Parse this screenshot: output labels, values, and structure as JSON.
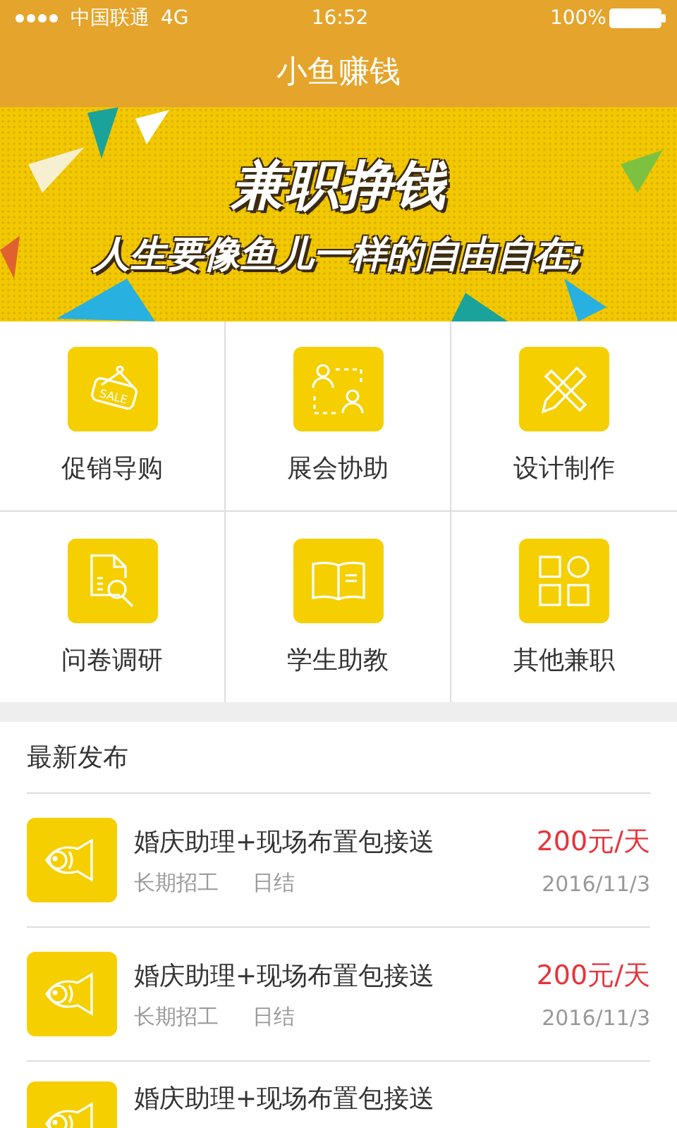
{
  "status_bar": {
    "carrier": "中国联通",
    "network": "4G",
    "time": "16:52",
    "battery": "100%"
  },
  "nav_bar": {
    "title": "小鱼赚钱"
  },
  "banner": {
    "headline": "兼职挣钱",
    "slogan": "人生要像鱼儿一样的自由自在;"
  },
  "categories": [
    {
      "label": "促销导购",
      "kind": "sale",
      "icon_text": "SALE"
    },
    {
      "label": "展会协助",
      "kind": "people"
    },
    {
      "label": "设计制作",
      "kind": "design"
    },
    {
      "label": "问卷调研",
      "kind": "survey"
    },
    {
      "label": "学生助教",
      "kind": "book"
    },
    {
      "label": "其他兼职",
      "kind": "grid"
    }
  ],
  "latest": {
    "heading": "最新发布",
    "jobs": [
      {
        "title": "婚庆助理+现场布置包接送",
        "term": "长期招工",
        "payment": "日结",
        "pay": "200元/天",
        "date": "2016/11/3"
      },
      {
        "title": "婚庆助理+现场布置包接送",
        "term": "长期招工",
        "payment": "日结",
        "pay": "200元/天",
        "date": "2016/11/3"
      },
      {
        "title": "婚庆助理+现场布置包接送"
      }
    ]
  }
}
